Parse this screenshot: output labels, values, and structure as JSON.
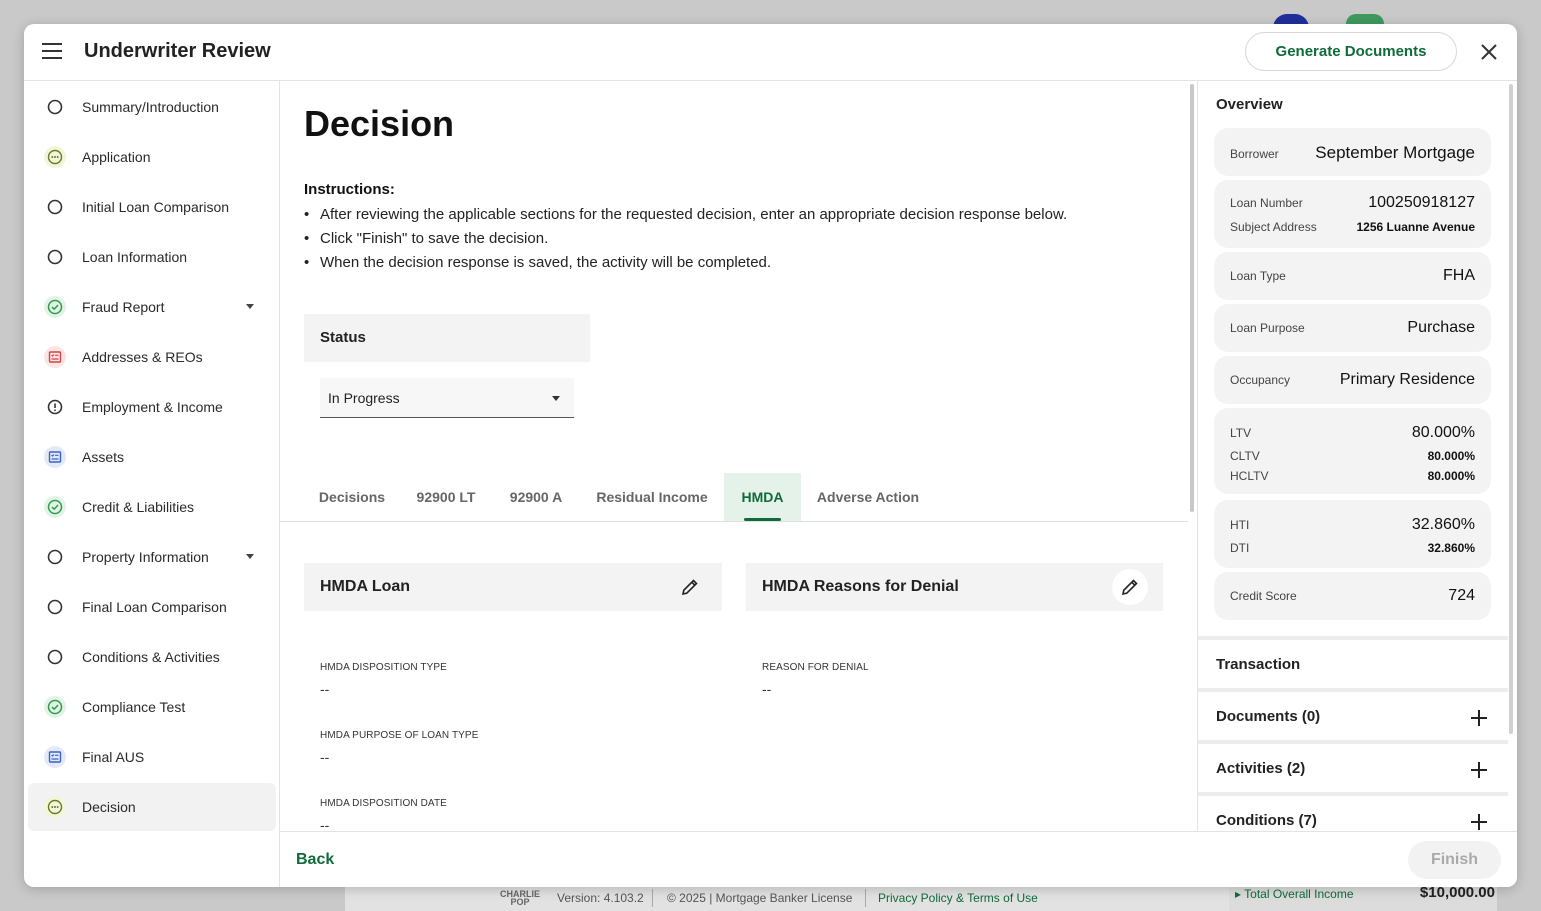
{
  "modal": {
    "title": "Underwriter Review",
    "generate_label": "Generate Documents"
  },
  "nav": {
    "items": [
      {
        "label": "Summary/Introduction"
      },
      {
        "label": "Application"
      },
      {
        "label": "Initial Loan Comparison"
      },
      {
        "label": "Loan Information"
      },
      {
        "label": "Fraud Report"
      },
      {
        "label": "Addresses & REOs"
      },
      {
        "label": "Employment & Income"
      },
      {
        "label": "Assets"
      },
      {
        "label": "Credit & Liabilities"
      },
      {
        "label": "Property Information"
      },
      {
        "label": "Final Loan Comparison"
      },
      {
        "label": "Conditions & Activities"
      },
      {
        "label": "Compliance Test"
      },
      {
        "label": "Final AUS"
      },
      {
        "label": "Decision"
      }
    ]
  },
  "main": {
    "title": "Decision",
    "instructions_title": "Instructions:",
    "instructions": [
      "After reviewing the applicable sections for the requested decision, enter an appropriate decision response below.",
      "Click \"Finish\" to save the decision.",
      "When the decision response is saved, the activity will be completed."
    ],
    "status_label": "Status",
    "status_value": "In Progress",
    "tabs": [
      {
        "label": "Decisions"
      },
      {
        "label": "92900 LT"
      },
      {
        "label": "92900 A"
      },
      {
        "label": "Residual Income"
      },
      {
        "label": "HMDA"
      },
      {
        "label": "Adverse Action"
      }
    ],
    "hmda_loan": {
      "title": "HMDA Loan",
      "fields": [
        {
          "label": "HMDA Disposition Type",
          "value": "--"
        },
        {
          "label": "HMDA Purpose of Loan Type",
          "value": "--"
        },
        {
          "label": "HMDA Disposition Date",
          "value": "--"
        }
      ]
    },
    "hmda_denial": {
      "title": "HMDA Reasons for Denial",
      "fields": [
        {
          "label": "Reason for Denial",
          "value": "--"
        }
      ]
    }
  },
  "footer": {
    "back_label": "Back",
    "finish_label": "Finish"
  },
  "overview": {
    "title": "Overview",
    "borrower_label": "Borrower",
    "borrower": "September Mortgage",
    "loan_number_label": "Loan Number",
    "loan_number": "100250918127",
    "address_label": "Subject Address",
    "address": "1256 Luanne Avenue",
    "loan_type_label": "Loan Type",
    "loan_type": "FHA",
    "purpose_label": "Loan Purpose",
    "purpose": "Purchase",
    "occupancy_label": "Occupancy",
    "occupancy": "Primary Residence",
    "ltv_label": "LTV",
    "ltv": "80.000%",
    "cltv_label": "CLTV",
    "cltv": "80.000%",
    "hcltv_label": "HCLTV",
    "hcltv": "80.000%",
    "hti_label": "HTI",
    "hti": "32.860%",
    "dti_label": "DTI",
    "dti": "32.860%",
    "credit_label": "Credit Score",
    "credit": "724",
    "sections": [
      {
        "label": "Transaction"
      },
      {
        "label": "Documents (0)"
      },
      {
        "label": "Activities (2)"
      },
      {
        "label": "Conditions (7)"
      }
    ]
  },
  "background": {
    "version": "Version: 4.103.2",
    "copyright": "© 2025 | Mortgage Banker License",
    "privacy": "Privacy Policy & Terms of Use",
    "income_label": "Total Overall Income",
    "income_value": "$10,000.00",
    "logo": "CHARLIE POP"
  },
  "colors": {
    "accent": "#0f6b3a",
    "tab_active_bg": "#e5f2ea",
    "status_success": "#2e9c4f",
    "status_error": "#d04545",
    "status_info": "#3b63c4"
  }
}
